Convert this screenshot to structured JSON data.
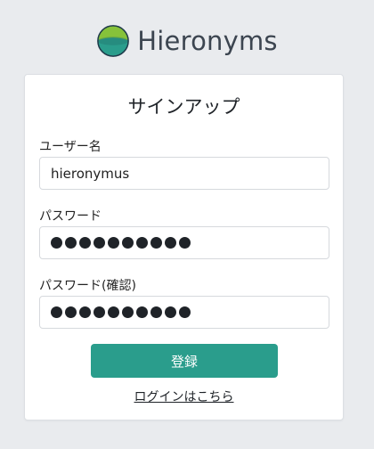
{
  "brand": {
    "name": "Hieronyms",
    "logo_colors": {
      "top": "#7fbf2f",
      "bottom": "#2a9d8c",
      "ring": "#1f3a4a"
    }
  },
  "form": {
    "title": "サインアップ",
    "username": {
      "label": "ユーザー名",
      "value": "hieronymus"
    },
    "password": {
      "label": "パスワード",
      "masked_length": 10
    },
    "password_confirm": {
      "label": "パスワード(確認)",
      "masked_length": 10
    },
    "submit_label": "登録",
    "login_link_label": "ログインはこちら"
  },
  "colors": {
    "background": "#e9ebee",
    "accent": "#2a9d8c",
    "card": "#ffffff"
  }
}
